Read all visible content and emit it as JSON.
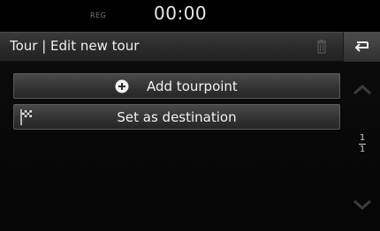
{
  "status": {
    "reg": "REG",
    "clock": "00:00"
  },
  "header": {
    "title": "Tour | Edit new tour"
  },
  "list": {
    "add_label": "Add tourpoint",
    "destination_label": "Set as destination"
  },
  "pager": {
    "current": "1",
    "total": "1"
  },
  "icons": {
    "trash": "trash-icon",
    "back": "back-arrow-icon",
    "add": "plus-circle-icon",
    "flag": "checkered-flag-icon",
    "up": "chevron-up-icon",
    "down": "chevron-down-icon"
  }
}
